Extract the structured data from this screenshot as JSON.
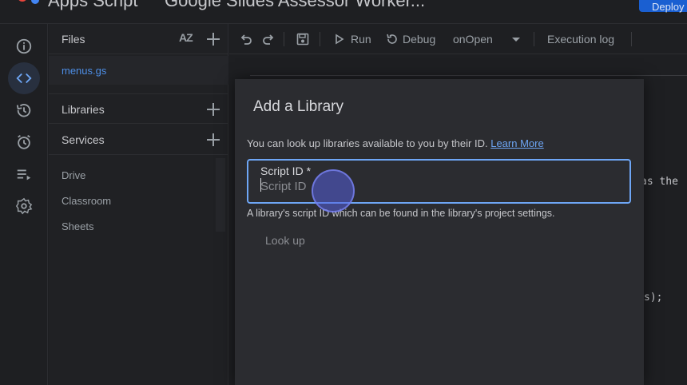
{
  "app": {
    "name": "Apps Script",
    "project_title": "Google Slides Assessor Worker...",
    "deploy_label": "Deploy"
  },
  "rail": {
    "items": [
      {
        "name": "overview",
        "icon": "info-icon"
      },
      {
        "name": "editor",
        "icon": "code-icon",
        "active": true
      },
      {
        "name": "executions",
        "icon": "history-icon"
      },
      {
        "name": "triggers",
        "icon": "alarm-icon"
      },
      {
        "name": "executions-list",
        "icon": "playlist-icon"
      },
      {
        "name": "settings",
        "icon": "gear-icon"
      }
    ]
  },
  "files_panel": {
    "files_title": "Files",
    "sort_label": "AZ",
    "files": [
      "menus.gs"
    ],
    "libraries_title": "Libraries",
    "services_title": "Services",
    "services": [
      "Drive",
      "Classroom",
      "Sheets"
    ]
  },
  "toolbar": {
    "run_label": "Run",
    "debug_label": "Debug",
    "function_selected": "onOpen",
    "execution_log_label": "Execution log"
  },
  "editor": {
    "code_fragment_1": "as the",
    "code_fragment_2": "s);"
  },
  "dialog": {
    "title": "Add a Library",
    "description": "You can look up libraries available to you by their ID.",
    "learn_more": "Learn More",
    "field_label": "Script ID *",
    "field_placeholder": "Script ID",
    "field_value": "",
    "helper_text": "A library's script ID which can be found in the library's project settings.",
    "lookup_label": "Look up"
  },
  "colors": {
    "accent": "#6ea6f5",
    "deploy_button": "#1a5fd1",
    "background": "#1e1f22",
    "dialog_background": "#2b2c30"
  }
}
